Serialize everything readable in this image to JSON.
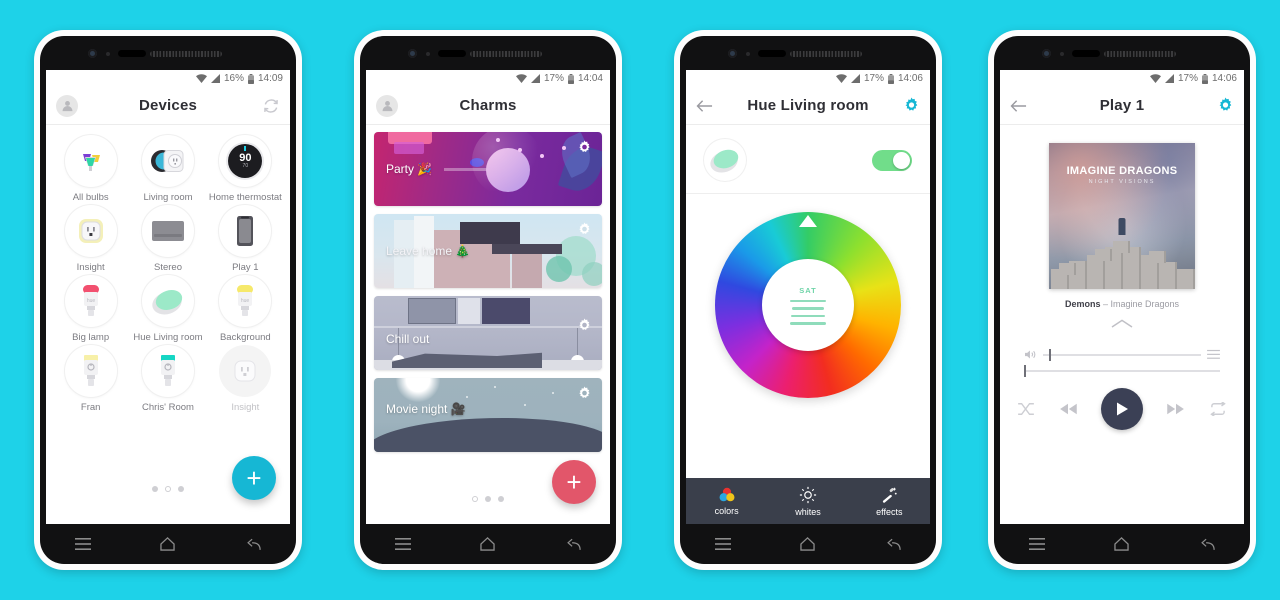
{
  "background_color": "#1ed2e8",
  "phones": [
    {
      "id": "devices",
      "status": {
        "battery": "16%",
        "time": "14:09",
        "wifi_icon": "wifi-icon",
        "signal_icon": "signal-icon",
        "battery_icon": "battery-icon"
      },
      "header": {
        "title": "Devices",
        "left_icon": "avatar-icon",
        "right_icon": "refresh-icon"
      },
      "devices": [
        {
          "label": "All bulbs",
          "icon": "multi-bulb-icon",
          "state": "on"
        },
        {
          "label": "Living room",
          "icon": "wemo-switch-icon",
          "state": "on"
        },
        {
          "label": "Home thermostat",
          "icon": "nest-thermostat-icon",
          "state": "on",
          "value": "90",
          "secondary_value": "70"
        },
        {
          "label": "Insight",
          "icon": "wemo-insight-icon",
          "state": "on"
        },
        {
          "label": "Stereo",
          "icon": "stereo-icon",
          "state": "on"
        },
        {
          "label": "Play 1",
          "icon": "speaker-icon",
          "state": "on"
        },
        {
          "label": "Big lamp",
          "icon": "hue-bulb-pink-icon",
          "state": "on"
        },
        {
          "label": "Hue Living room",
          "icon": "hue-go-icon",
          "state": "on"
        },
        {
          "label": "Background",
          "icon": "hue-bulb-yellow-icon",
          "state": "on"
        },
        {
          "label": "Fran",
          "icon": "hue-bulb-cream-icon",
          "state": "on"
        },
        {
          "label": "Chris' Room",
          "icon": "hue-bulb-teal-icon",
          "state": "on"
        },
        {
          "label": "Insight",
          "icon": "wemo-insight-off-icon",
          "state": "off"
        }
      ],
      "fab": {
        "label": "+",
        "color": "#16b7d4",
        "name": "add-device-button"
      },
      "pager": {
        "count": 3,
        "current": 1
      }
    },
    {
      "id": "charms",
      "status": {
        "battery": "17%",
        "time": "14:04"
      },
      "header": {
        "title": "Charms",
        "left_icon": "avatar-icon"
      },
      "cards": [
        {
          "label": "Party 🎉",
          "art": "party",
          "gear": "gear-icon"
        },
        {
          "label": "Leave home 🎄",
          "art": "leave",
          "gear": "gear-icon"
        },
        {
          "label": "Chill out",
          "art": "chill",
          "gear": "gear-icon"
        },
        {
          "label": "Movie night 🎥",
          "art": "movie",
          "gear": "gear-icon"
        }
      ],
      "fab": {
        "label": "+",
        "color": "#e2566a",
        "name": "add-charm-button"
      },
      "pager": {
        "count": 3,
        "current": 0
      }
    },
    {
      "id": "hue_detail",
      "status": {
        "battery": "17%",
        "time": "14:06"
      },
      "header": {
        "title": "Hue Living room",
        "left_icon": "back-arrow-icon",
        "right_icon": "gear-icon",
        "right_icon_color": "#16b7d4"
      },
      "light": {
        "icon": "hue-go-icon",
        "toggle_state": "on",
        "toggle_color": "#71dd8a"
      },
      "color_picker": {
        "type": "color-wheel",
        "center_label": "SAT",
        "center_control": "saturation-slider"
      },
      "tabs": [
        {
          "label": "colors",
          "icon": "color-circles-icon",
          "active": true
        },
        {
          "label": "whites",
          "icon": "sun-icon",
          "active": false
        },
        {
          "label": "effects",
          "icon": "magic-wand-icon",
          "active": false
        }
      ]
    },
    {
      "id": "player",
      "status": {
        "battery": "17%",
        "time": "14:06"
      },
      "header": {
        "title": "Play 1",
        "left_icon": "back-arrow-icon",
        "right_icon": "gear-icon",
        "right_icon_color": "#16b7d4"
      },
      "album": {
        "artist_line": "IMAGINE DRAGONS",
        "album_line": "NIGHT VISIONS"
      },
      "now_playing": {
        "track": "Demons",
        "dash": " – ",
        "artist": "Imagine Dragons"
      },
      "expand_icon": "chevron-up-icon",
      "volume": {
        "icon": "volume-icon",
        "level_percent": 4,
        "playlist_icon": "playlist-icon"
      },
      "progress": {
        "percent": 1
      },
      "controls": [
        {
          "name": "shuffle-button",
          "icon": "shuffle-icon",
          "enabled": false
        },
        {
          "name": "previous-button",
          "icon": "previous-icon",
          "enabled": true
        },
        {
          "name": "play-button",
          "icon": "play-icon",
          "enabled": true
        },
        {
          "name": "next-button",
          "icon": "next-icon",
          "enabled": true
        },
        {
          "name": "repeat-button",
          "icon": "repeat-icon",
          "enabled": false
        }
      ]
    }
  ],
  "android_nav": {
    "menu": "menu-icon",
    "home": "home-icon",
    "back": "back-icon"
  }
}
